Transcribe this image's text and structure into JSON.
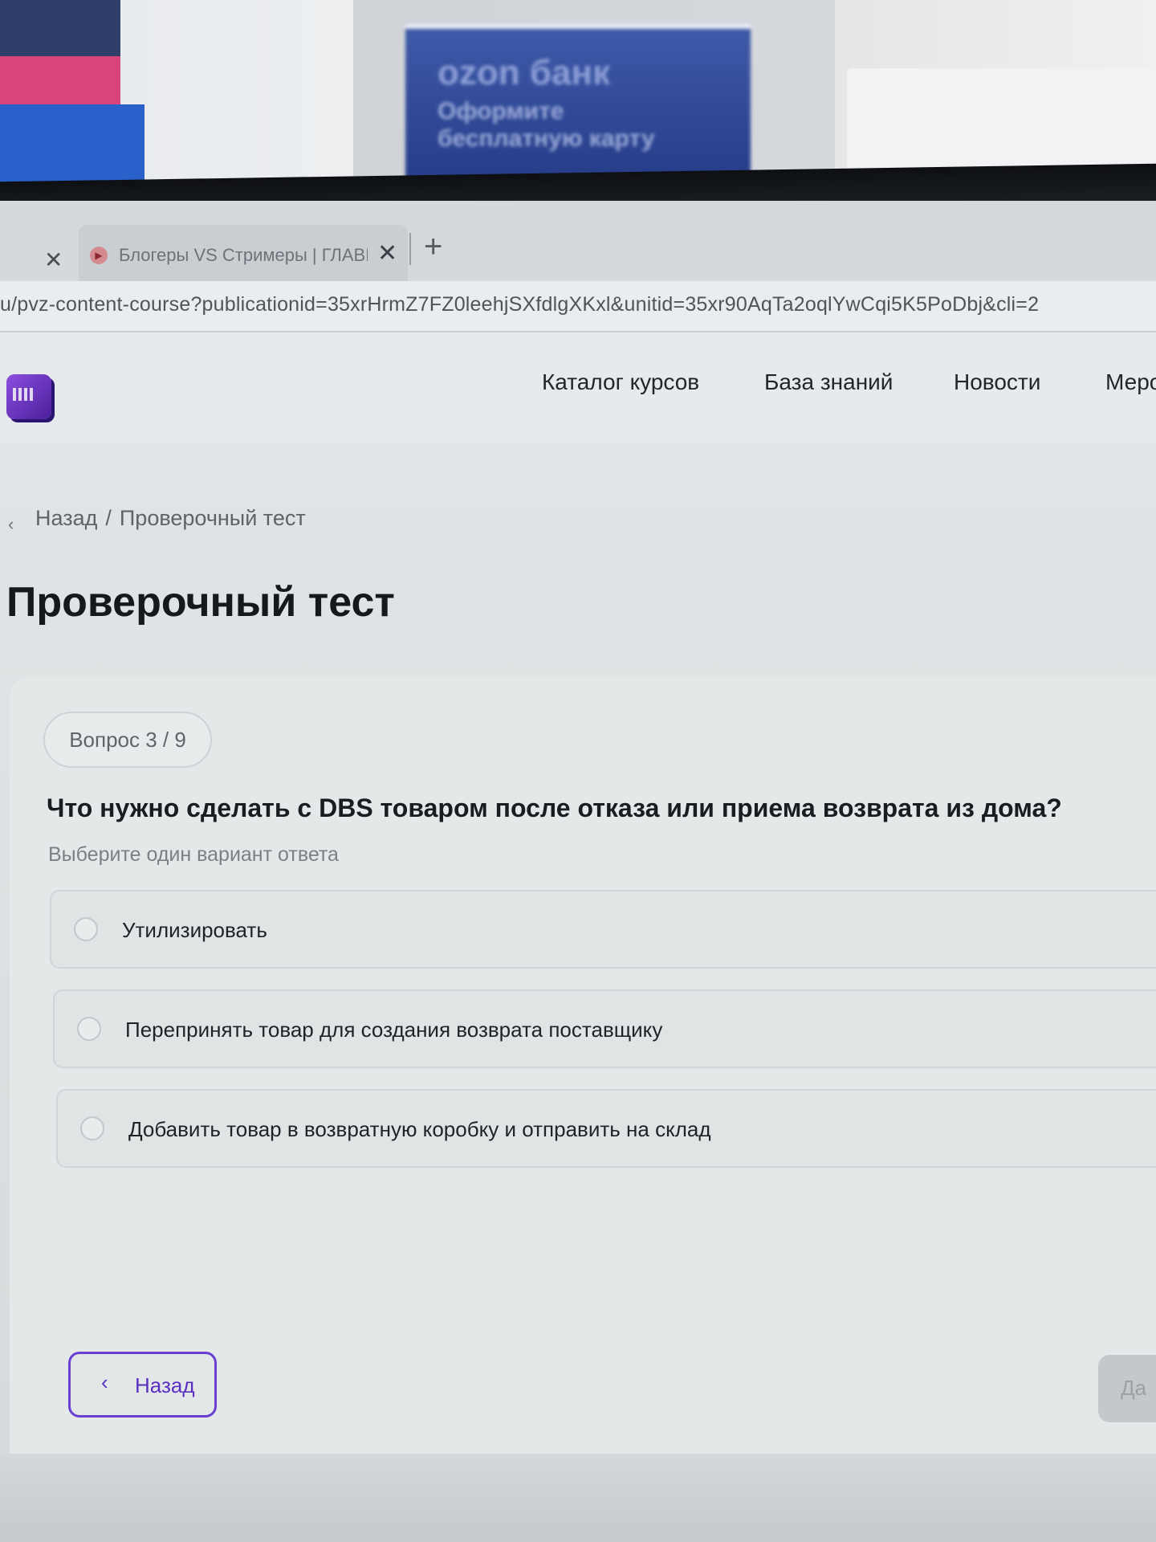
{
  "room": {
    "banner_line1": "ozon банк",
    "banner_line2": "Оформите",
    "banner_line3": "бесплатную карту"
  },
  "browser": {
    "tab_title": "Блогеры VS Стримеры | ГЛАВНЫ",
    "url": "u/pvz-content-course?publicationid=35xrHrmZ7FZ0leehjSXfdlgXKxl&unitid=35xr90AqTa2oqlYwCqi5K5PoDbj&cli=2"
  },
  "nav": {
    "items": [
      "Каталог курсов",
      "База знаний",
      "Новости",
      "Меро"
    ]
  },
  "breadcrumb": {
    "back": "Назад",
    "separator": "/",
    "current": "Проверочный тест"
  },
  "page": {
    "title": "Проверочный тест"
  },
  "quiz": {
    "progress": "Вопрос 3 / 9",
    "question": "Что нужно сделать с DBS товаром после отказа или приема возврата из дома?",
    "hint": "Выберите один вариант ответа",
    "options": [
      "Утилизировать",
      "Перепринять товар для создания возврата поставщику",
      "Добавить товар в возвратную коробку и отправить на склад"
    ]
  },
  "buttons": {
    "back": "Назад",
    "next": "Да"
  },
  "colors": {
    "accent": "#6a3fd2",
    "text": "#1a1d20",
    "muted": "#7a8085"
  }
}
